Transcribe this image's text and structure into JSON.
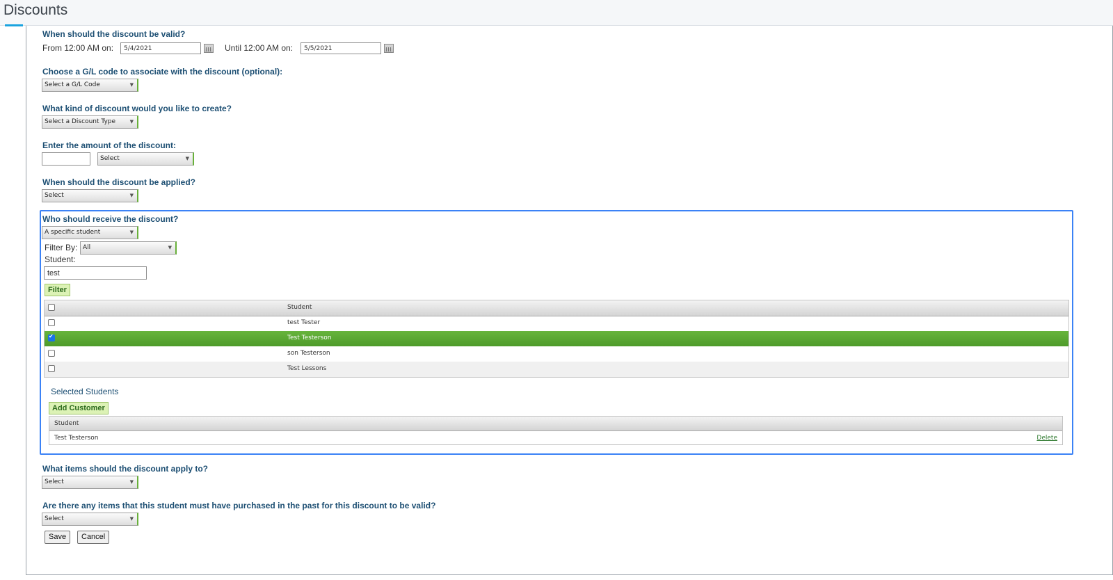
{
  "header": {
    "title": "Discounts"
  },
  "validity": {
    "question": "When should the discount be valid?",
    "from_label": "From 12:00 AM on:",
    "from_value": "5/4/2021",
    "until_label": "Until 12:00 AM on:",
    "until_value": "5/5/2021"
  },
  "gl_code": {
    "question": "Choose a G/L code to associate with the discount (optional):",
    "selected": "Select a G/L Code"
  },
  "discount_type": {
    "question": "What kind of discount would you like to create?",
    "selected": "Select a Discount Type"
  },
  "amount": {
    "question": "Enter the amount of the discount:",
    "value": "",
    "unit_selected": "Select"
  },
  "applied": {
    "question": "When should the discount be applied?",
    "selected": "Select"
  },
  "receiver": {
    "question": "Who should receive the discount?",
    "selected": "A specific student",
    "filter_by_label": "Filter By:",
    "filter_by_selected": "All",
    "student_label": "Student:",
    "student_value": "test",
    "filter_button": "Filter",
    "grid": {
      "header": "Student",
      "rows": [
        {
          "name": "test Tester",
          "checked": false
        },
        {
          "name": "Test Testerson",
          "checked": true
        },
        {
          "name": "son Testerson",
          "checked": false
        },
        {
          "name": "Test Lessons",
          "checked": false
        }
      ]
    },
    "selected_title": "Selected Students",
    "add_customer_button": "Add Customer",
    "selected_grid": {
      "header": "Student",
      "rows": [
        {
          "name": "Test Testerson",
          "action": "Delete"
        }
      ]
    }
  },
  "items": {
    "question": "What items should the discount apply to?",
    "selected": "Select"
  },
  "past_items": {
    "question": "Are there any items that this student must have purchased in the past for this discount to be valid?",
    "selected": "Select"
  },
  "actions": {
    "save": "Save",
    "cancel": "Cancel"
  },
  "colors": {
    "accent": "#1aa3df",
    "question_text": "#1d4f73",
    "selected_row": "#5aa834",
    "focus_border": "#3b82f6"
  }
}
